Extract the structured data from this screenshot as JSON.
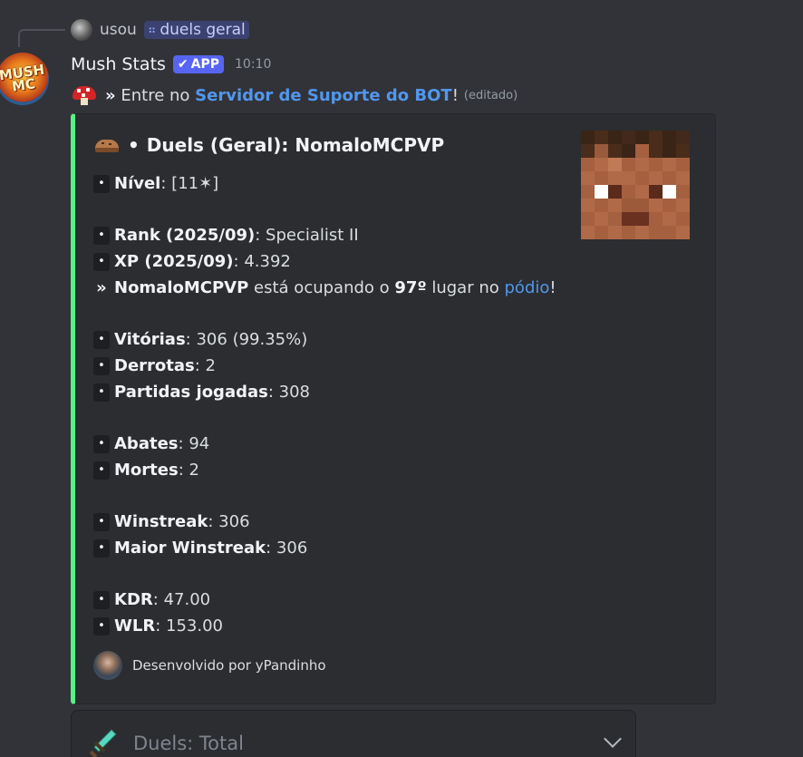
{
  "reply": {
    "user": "usou",
    "command": "duels geral",
    "command_icon": "apps-icon"
  },
  "message": {
    "author": "Mush Stats",
    "author_avatar_text": "MUSH MC",
    "badge": "APP",
    "badge_icon": "checkmark-icon",
    "timestamp": "10:10",
    "content_prefix": "»",
    "content_text": "Entre no",
    "content_link": "Servidor de Suporte do BOT",
    "content_suffix": "!",
    "edited_label": "(editado)",
    "emoji": "red-mushroom-icon"
  },
  "embed": {
    "accent_color": "#57f287",
    "title_emoji": "bread-icon",
    "title_separator": "•",
    "title": "Duels (Geral): NomaloMCPVP",
    "thumbnail": "minecraft-skin-head",
    "bullet": "•",
    "arrow": "»",
    "nivel": {
      "label": "Nível",
      "sep": ":",
      "value": "[11✶]"
    },
    "rank": {
      "label": "Rank (2025/09)",
      "sep": ":",
      "value": "Specialist II"
    },
    "xp": {
      "label": "XP (2025/09)",
      "sep": ":",
      "value": "4.392"
    },
    "podium": {
      "player": "NomaloMCPVP",
      "text_1": "está ocupando o",
      "position": "97º",
      "text_2": "lugar no",
      "link": "pódio",
      "end": "!"
    },
    "vitorias": {
      "label": "Vitórias",
      "sep": ":",
      "value": "306 (99.35%)"
    },
    "derrotas": {
      "label": "Derrotas",
      "sep": ":",
      "value": "2"
    },
    "partidas": {
      "label": "Partidas jogadas",
      "sep": ":",
      "value": "308"
    },
    "abates": {
      "label": "Abates",
      "sep": ":",
      "value": "94"
    },
    "mortes": {
      "label": "Mortes",
      "sep": ":",
      "value": "2"
    },
    "winstreak": {
      "label": "Winstreak",
      "sep": ":",
      "value": "306"
    },
    "maior_winstreak": {
      "label": "Maior Winstreak",
      "sep": ":",
      "value": "306"
    },
    "kdr": {
      "label": "KDR",
      "sep": ":",
      "value": "47.00"
    },
    "wlr": {
      "label": "WLR",
      "sep": ":",
      "value": "153.00"
    },
    "footer": "Desenvolvido por yPandinho"
  },
  "select_menu": {
    "icon": "diamond-sword-icon",
    "label": "Duels: Total",
    "chevron": "chevron-down-icon"
  }
}
